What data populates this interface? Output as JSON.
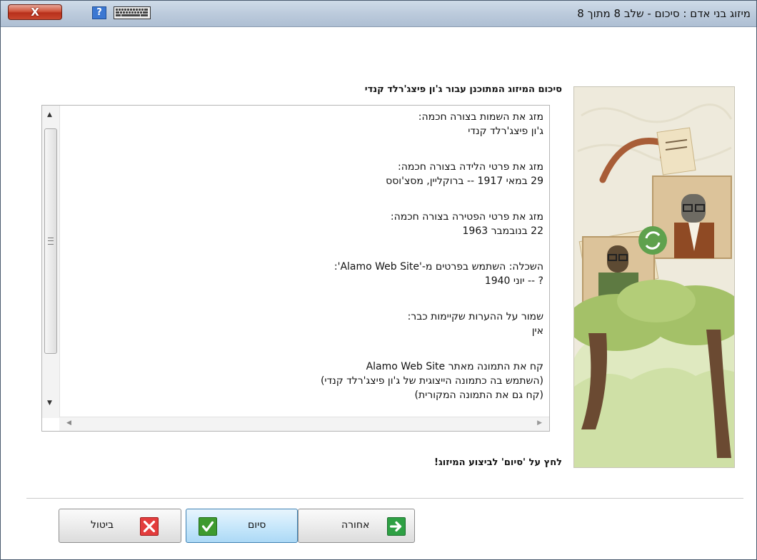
{
  "window": {
    "title": "מיזוג בני אדם : סיכום -  שלב 8 מתוך 8",
    "close_label": "X",
    "help_label": "?"
  },
  "summary": {
    "heading": "סיכום המיזוג המתוכנן עבור ג'ון פיצג'רלד קנדי",
    "blocks": [
      {
        "lines": [
          "מזג את השמות בצורה חכמה:",
          "ג'ון פיצג'רלד קנדי"
        ]
      },
      {
        "lines": [
          "מזג את פרטי הלידה בצורה חכמה:",
          "29 במאי 1917 -- ברוקליין, מסצ'וסס"
        ]
      },
      {
        "lines": [
          "מזג את פרטי הפטירה בצורה חכמה:",
          "22 בנובמבר 1963"
        ]
      },
      {
        "lines": [
          "השכלה: השתמש בפרטים מ-'Alamo Web Site':",
          "? -- יוני 1940"
        ]
      },
      {
        "lines": [
          "שמור על ההערות שקיימות כבר:",
          "אין"
        ]
      },
      {
        "lines": [
          "קח את התמונה מאתר Alamo Web Site",
          "(השתמש בה כתמונה הייצוגית של ג'ון פיצג'רלד קנדי)",
          "(קח גם את התמונה המקורית)"
        ]
      }
    ]
  },
  "finish_hint": "לחץ על 'סיום' לביצוע המיזוג!",
  "buttons": {
    "cancel": "ביטול",
    "finish": "סיום",
    "back": "אחורה"
  },
  "icons": {
    "close": "close-icon",
    "help": "help-icon",
    "keyboard": "keyboard-icon",
    "cancel": "red-x-icon",
    "finish": "green-check-icon",
    "back": "green-arrow-icon"
  },
  "colors": {
    "accent": "#3c7fb1",
    "cancel": "#e33d3d",
    "finish": "#3e9a2e",
    "back": "#2ea044"
  }
}
